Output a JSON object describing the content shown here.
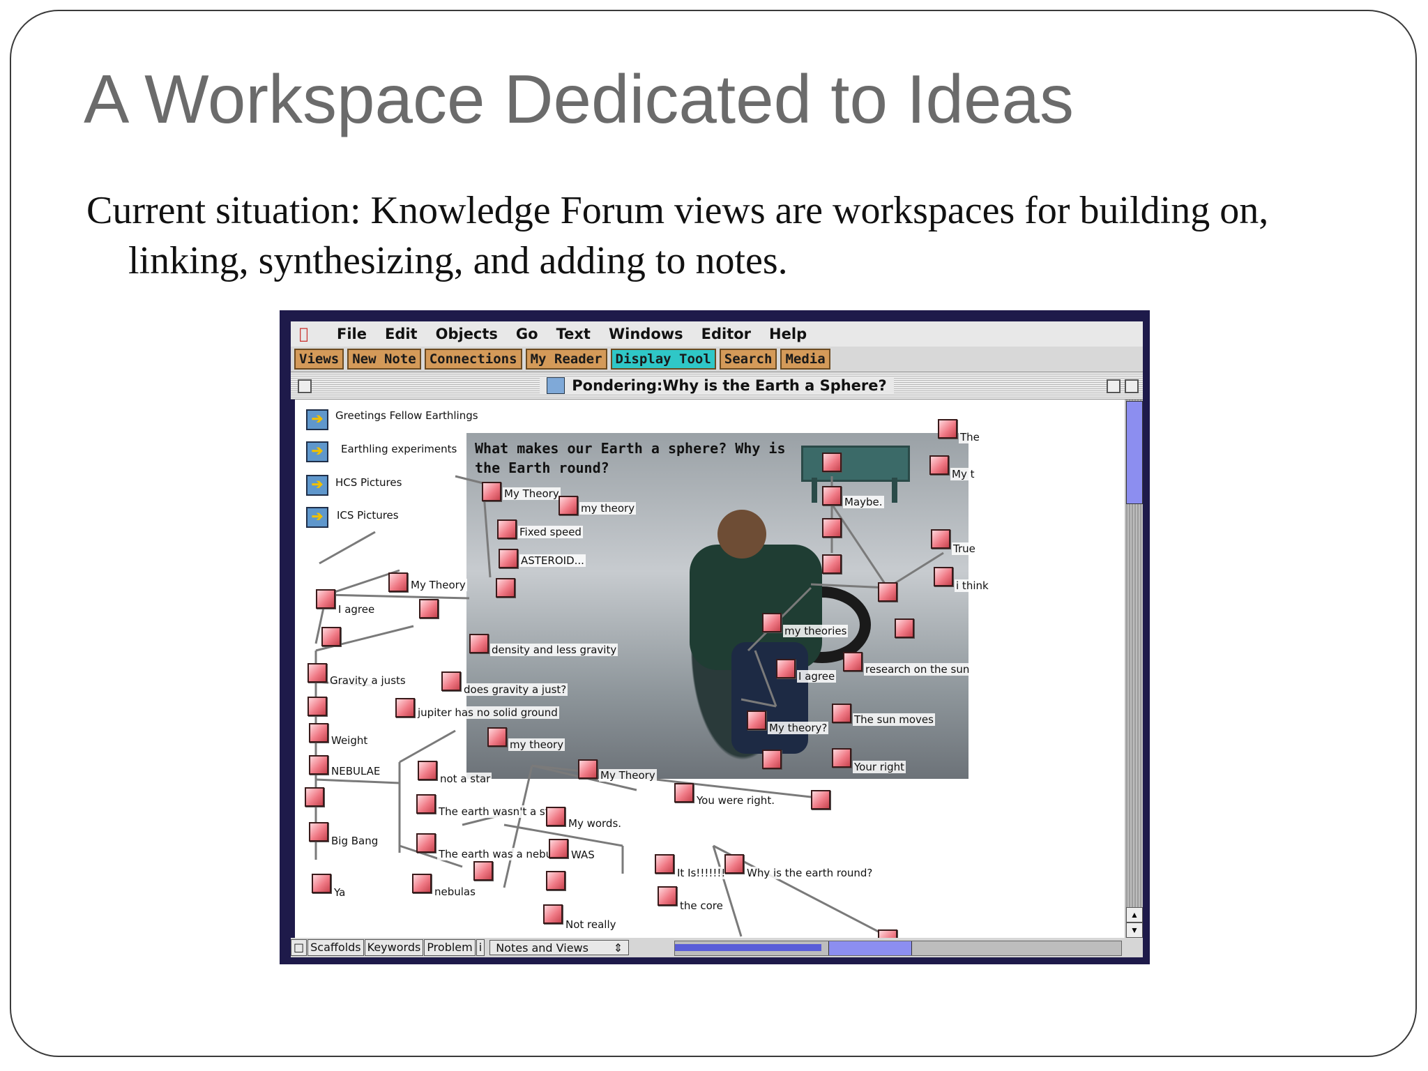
{
  "slide": {
    "title": "A Workspace Dedicated to Ideas",
    "body": "Current situation: Knowledge Forum views are workspaces for building on, linking, synthesizing, and adding to notes."
  },
  "app": {
    "menu": [
      "File",
      "Edit",
      "Objects",
      "Go",
      "Text",
      "Windows",
      "Editor",
      "Help"
    ],
    "toolbar": [
      {
        "label": "Views",
        "active": false
      },
      {
        "label": "New Note",
        "active": false
      },
      {
        "label": "Connections",
        "active": false
      },
      {
        "label": "My Reader",
        "active": false
      },
      {
        "label": "Display Tool",
        "active": true
      },
      {
        "label": "Search",
        "active": false
      },
      {
        "label": "Media",
        "active": false
      }
    ],
    "window_title": "Pondering:Why is the Earth a Sphere?",
    "photo_question": "What makes our Earth a sphere? Why is the Earth round?",
    "view_links": [
      "Greetings Fellow Earthlings",
      "Earthling experiments",
      "HCS Pictures",
      "ICS Pictures"
    ],
    "note_labels": [
      "My Theory",
      "my theory",
      "Fixed speed",
      "ASTEROID...",
      "My Theory",
      "I agree",
      "density   and less gravity",
      "Gravity a justs",
      "does gravity a just?",
      "jupiter has no solid ground",
      "Weight",
      "my theory",
      "NEBULAE",
      "not a star",
      "The earth wasn't a star",
      "Big Bang",
      "The earth was a nebula",
      "Ya",
      "nebulas",
      "My Theory",
      "You were right.",
      "My words.",
      "WAS",
      "It Is!!!!!!!",
      "the core",
      "Not really",
      "Why is the earth round?",
      "Maybe.",
      "True",
      "i think",
      "my theories",
      "research on the sun",
      "I agree",
      "The sun moves",
      "My theory?",
      "Your right",
      "The",
      "My t"
    ],
    "status": {
      "buttons": [
        "Scaffolds",
        "Keywords",
        "Problem",
        "i"
      ],
      "select": "Notes and Views"
    },
    "icons": [
      "apple-icon",
      "close-box-icon",
      "view-link-arrow-icon",
      "note-icon",
      "scroll-arrow-icon"
    ]
  }
}
